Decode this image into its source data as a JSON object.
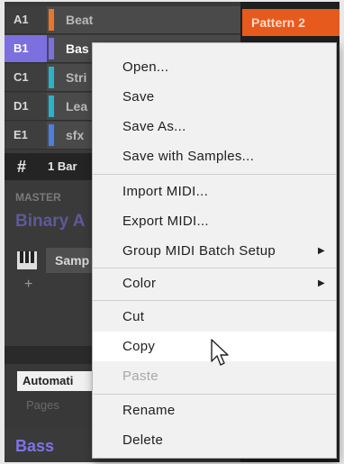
{
  "groups": [
    {
      "slot": "A1",
      "name": "Beat",
      "color": "#e8762b"
    },
    {
      "slot": "B1",
      "name": "Bas",
      "color": "#7c6fe0",
      "selected": true
    },
    {
      "slot": "C1",
      "name": "Stri",
      "color": "#2ab3c8"
    },
    {
      "slot": "D1",
      "name": "Lea",
      "color": "#2ab3c8"
    },
    {
      "slot": "E1",
      "name": "sfx",
      "color": "#4a7fe0"
    }
  ],
  "bar": {
    "hash": "#",
    "label": "1 Bar"
  },
  "master": {
    "label": "MASTER",
    "kit_name": "Binary A"
  },
  "sampler": {
    "label": "Samp"
  },
  "plus": "+",
  "automation": {
    "button": "Automati",
    "pages": "Pages"
  },
  "bottom_group": "Bass",
  "pattern": {
    "label": "Pattern 2",
    "color": "#e65a1e"
  },
  "menu": {
    "items": [
      {
        "label": "Open...",
        "submenu": false,
        "disabled": false,
        "highlighted": false
      },
      {
        "label": "Save",
        "submenu": false,
        "disabled": false,
        "highlighted": false
      },
      {
        "label": "Save As...",
        "submenu": false,
        "disabled": false,
        "highlighted": false
      },
      {
        "label": "Save with Samples...",
        "submenu": false,
        "disabled": false,
        "highlighted": false
      },
      {
        "label": "Import MIDI...",
        "submenu": false,
        "disabled": false,
        "highlighted": false
      },
      {
        "label": "Export MIDI...",
        "submenu": false,
        "disabled": false,
        "highlighted": false
      },
      {
        "label": "Group MIDI Batch Setup",
        "submenu": true,
        "disabled": false,
        "highlighted": false
      },
      {
        "label": "Color",
        "submenu": true,
        "disabled": false,
        "highlighted": false
      },
      {
        "label": "Cut",
        "submenu": false,
        "disabled": false,
        "highlighted": false
      },
      {
        "label": "Copy",
        "submenu": false,
        "disabled": false,
        "highlighted": true
      },
      {
        "label": "Paste",
        "submenu": false,
        "disabled": true,
        "highlighted": false
      },
      {
        "label": "Rename",
        "submenu": false,
        "disabled": false,
        "highlighted": false
      },
      {
        "label": "Delete",
        "submenu": false,
        "disabled": false,
        "highlighted": false
      }
    ],
    "submenu_arrow": "▶"
  },
  "icons": {
    "cursor": "mouse-pointer-icon",
    "piano": "piano-keys-icon"
  }
}
